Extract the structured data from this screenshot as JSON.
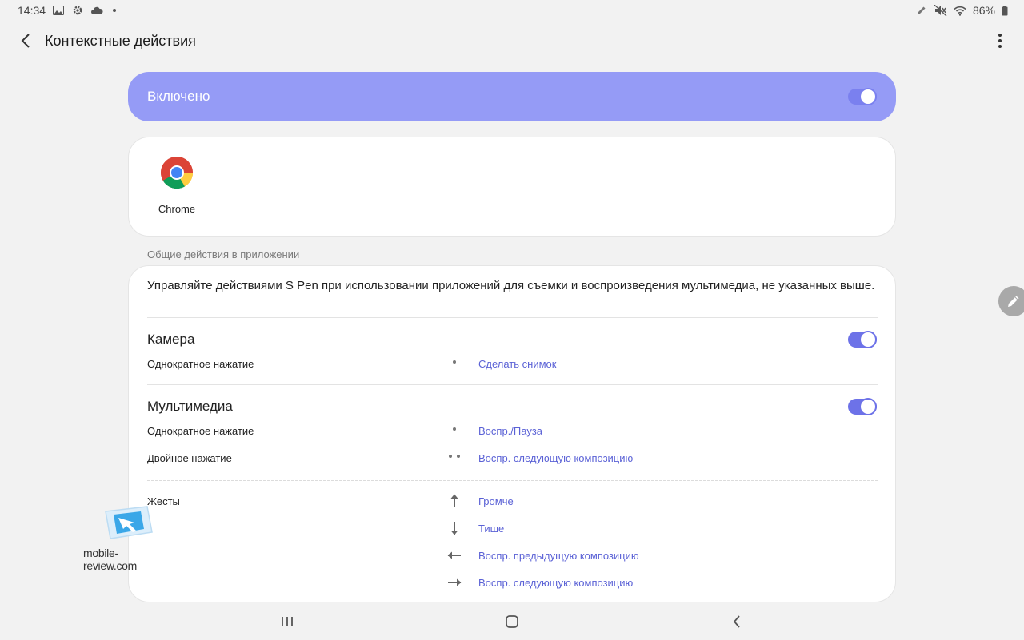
{
  "status_bar": {
    "time": "14:34",
    "battery": "86%"
  },
  "app_bar": {
    "title": "Контекстные действия"
  },
  "master_switch": {
    "label": "Включено",
    "on": true
  },
  "apps": [
    {
      "name": "Chrome",
      "icon": "chrome-icon"
    }
  ],
  "section": {
    "title": "Общие действия в приложении"
  },
  "settings": {
    "description": "Управляйте действиями S Pen при использовании приложений для съемки и воспроизведения мультимедиа, не указанных выше.",
    "camera": {
      "title": "Камера",
      "on": true,
      "rows": [
        {
          "label": "Однократное нажатие",
          "action": "Сделать снимок"
        }
      ]
    },
    "media": {
      "title": "Мультимедиа",
      "on": true,
      "rows": [
        {
          "label": "Однократное нажатие",
          "action": "Воспр./Пауза"
        },
        {
          "label": "Двойное нажатие",
          "action": "Воспр. следующую композицию"
        }
      ],
      "gestures_label": "Жесты",
      "gestures": [
        {
          "direction": "up",
          "action": "Громче"
        },
        {
          "direction": "down",
          "action": "Тише"
        },
        {
          "direction": "left",
          "action": "Воспр. предыдущую композицию"
        },
        {
          "direction": "right",
          "action": "Воспр. следующую композицию"
        }
      ]
    }
  },
  "watermark": {
    "text": "mobile-review.com"
  },
  "colors": {
    "accent": "#6d72e8",
    "banner": "#959bf6",
    "link": "#5b62d6"
  }
}
